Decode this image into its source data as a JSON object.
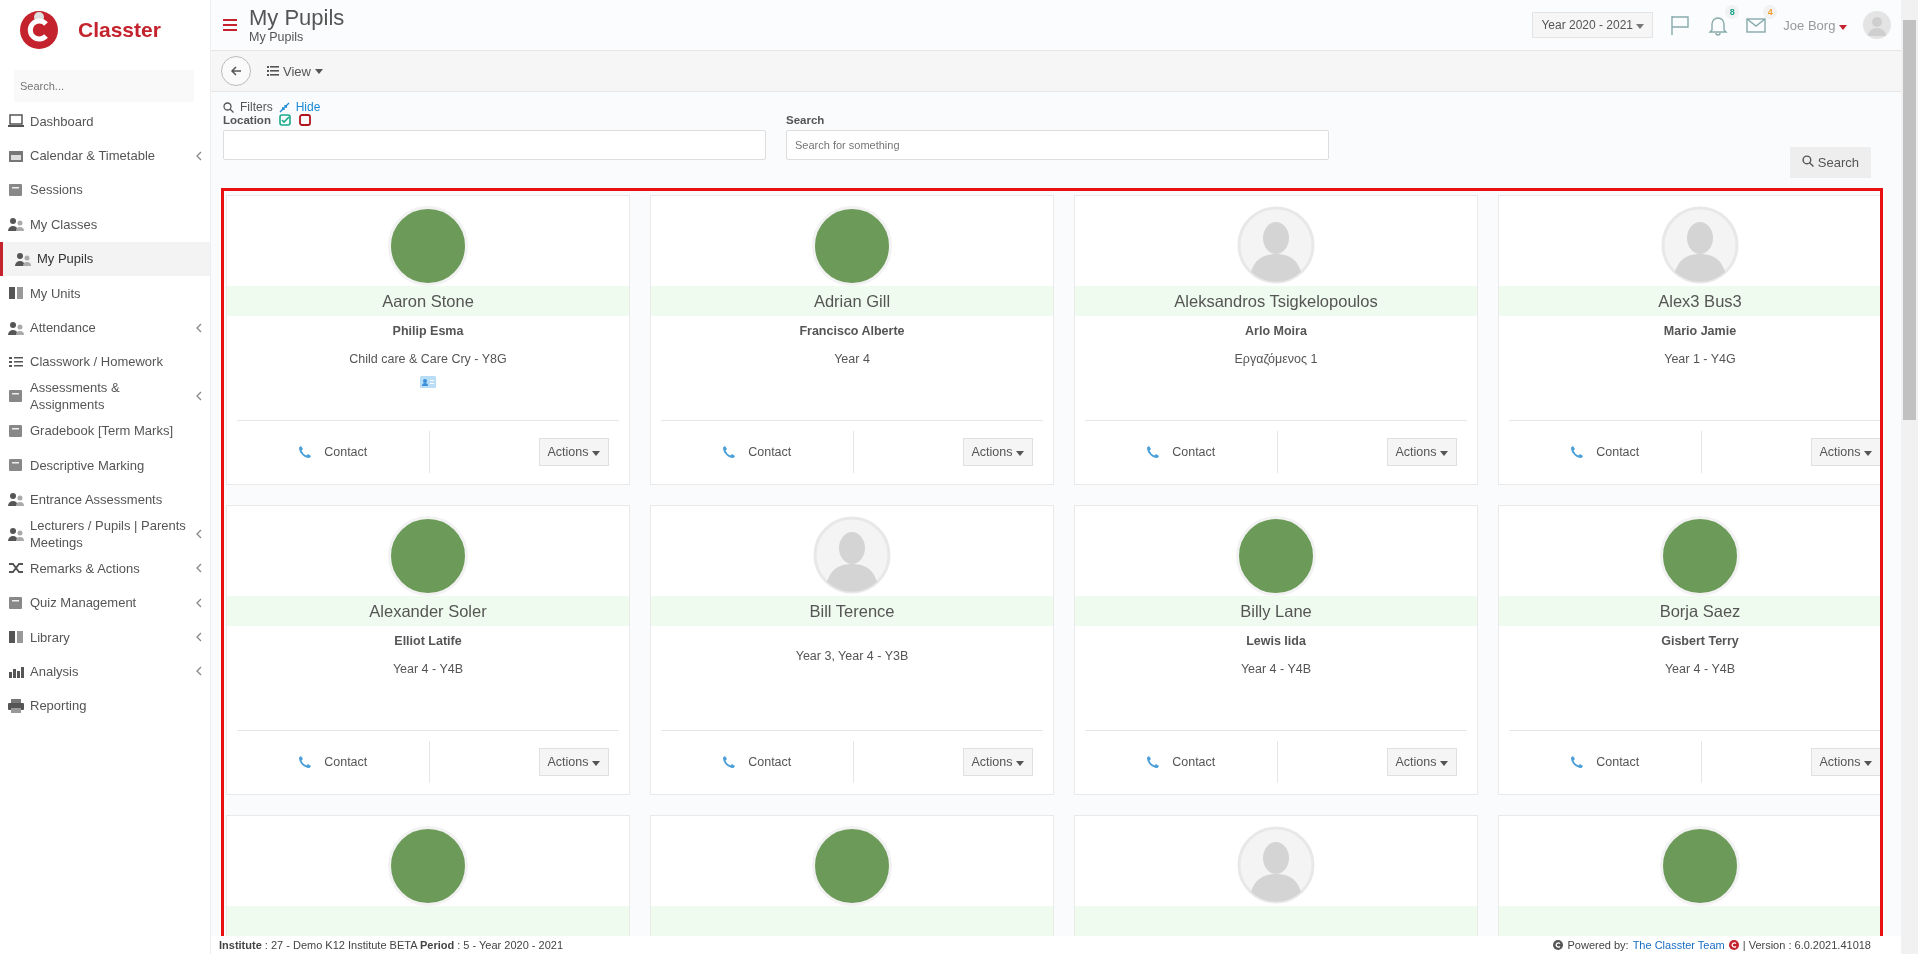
{
  "app": {
    "name": "Classter"
  },
  "sidebar": {
    "search": {
      "placeholder": "Search..."
    },
    "items": [
      {
        "label": "Dashboard",
        "selected": false,
        "expandable": false
      },
      {
        "label": "Calendar & Timetable",
        "selected": false,
        "expandable": true
      },
      {
        "label": "Sessions",
        "selected": false,
        "expandable": false
      },
      {
        "label": "My Classes",
        "selected": false,
        "expandable": false
      },
      {
        "label": "My Pupils",
        "selected": true,
        "expandable": false
      },
      {
        "label": "My Units",
        "selected": false,
        "expandable": false
      },
      {
        "label": "Attendance",
        "selected": false,
        "expandable": true
      },
      {
        "label": "Classwork / Homework",
        "selected": false,
        "expandable": false
      },
      {
        "label": "Assessments & Assignments",
        "selected": false,
        "expandable": true
      },
      {
        "label": "Gradebook [Term Marks]",
        "selected": false,
        "expandable": false
      },
      {
        "label": "Descriptive Marking",
        "selected": false,
        "expandable": false
      },
      {
        "label": "Entrance Assessments",
        "selected": false,
        "expandable": false
      },
      {
        "label": "Lecturers / Pupils | Parents Meetings",
        "selected": false,
        "expandable": true
      },
      {
        "label": "Remarks & Actions",
        "selected": false,
        "expandable": true
      },
      {
        "label": "Quiz Management",
        "selected": false,
        "expandable": true
      },
      {
        "label": "Library",
        "selected": false,
        "expandable": true
      },
      {
        "label": "Analysis",
        "selected": false,
        "expandable": true
      },
      {
        "label": "Reporting",
        "selected": false,
        "expandable": false
      }
    ]
  },
  "header": {
    "title": "My Pupils",
    "breadcrumb": "My Pupils",
    "year": "Year 2020 - 2021",
    "notifications": "8",
    "messages": "4",
    "user": "Joe Borg"
  },
  "toolbar": {
    "view": "View"
  },
  "filters": {
    "title": "Filters",
    "hide": "Hide",
    "location": {
      "label": "Location"
    },
    "search": {
      "label": "Search",
      "placeholder": "Search for something"
    },
    "button": "Search"
  },
  "pupils": [
    {
      "name": "Aaron Stone",
      "guardian": "Philip Esma",
      "class": "Child care & Care Cry  -  Y8G",
      "photo": true,
      "id_card": true,
      "contact": "Contact",
      "actions": "Actions"
    },
    {
      "name": "Adrian Gill",
      "guardian": "Francisco Alberte",
      "class": "Year 4",
      "photo": true,
      "id_card": false,
      "contact": "Contact",
      "actions": "Actions"
    },
    {
      "name": "Aleksandros Tsigkelopoulos",
      "guardian": "Arlo Moira",
      "class": "Εργαζόμενος 1",
      "photo": false,
      "id_card": false,
      "contact": "Contact",
      "actions": "Actions"
    },
    {
      "name": "Alex3 Bus3",
      "guardian": "Mario Jamie",
      "class": "Year 1  -  Y4G",
      "photo": false,
      "id_card": false,
      "contact": "Contact",
      "actions": "Actions"
    },
    {
      "name": "Alexander Soler",
      "guardian": "Elliot Latife",
      "class": "Year 4  -  Y4B",
      "photo": true,
      "id_card": false,
      "contact": "Contact",
      "actions": "Actions"
    },
    {
      "name": "Bill Terence",
      "class": "Year 3, Year 4  -  Y3B",
      "photo": false,
      "id_card": false,
      "contact": "Contact",
      "actions": "Actions"
    },
    {
      "name": "Billy Lane",
      "guardian": "Lewis Iida",
      "class": "Year 4  -  Y4B",
      "photo": true,
      "id_card": false,
      "contact": "Contact",
      "actions": "Actions"
    },
    {
      "name": "Borja Saez",
      "guardian": "Gisbert Terry",
      "class": "Year 4  -  Y4B",
      "photo": true,
      "id_card": false,
      "contact": "Contact",
      "actions": "Actions"
    },
    {
      "photo": true
    },
    {
      "photo": true
    },
    {
      "photo": false
    },
    {
      "photo": true
    }
  ],
  "footer": {
    "info": "**Institute** : 27 - Demo K12 Institute BETA **Period** : 5 - Year 2020 - 2021",
    "powered": "Powered by:",
    "team": "The Classter Team",
    "version": "| Version : 6.0.2021.41018"
  }
}
